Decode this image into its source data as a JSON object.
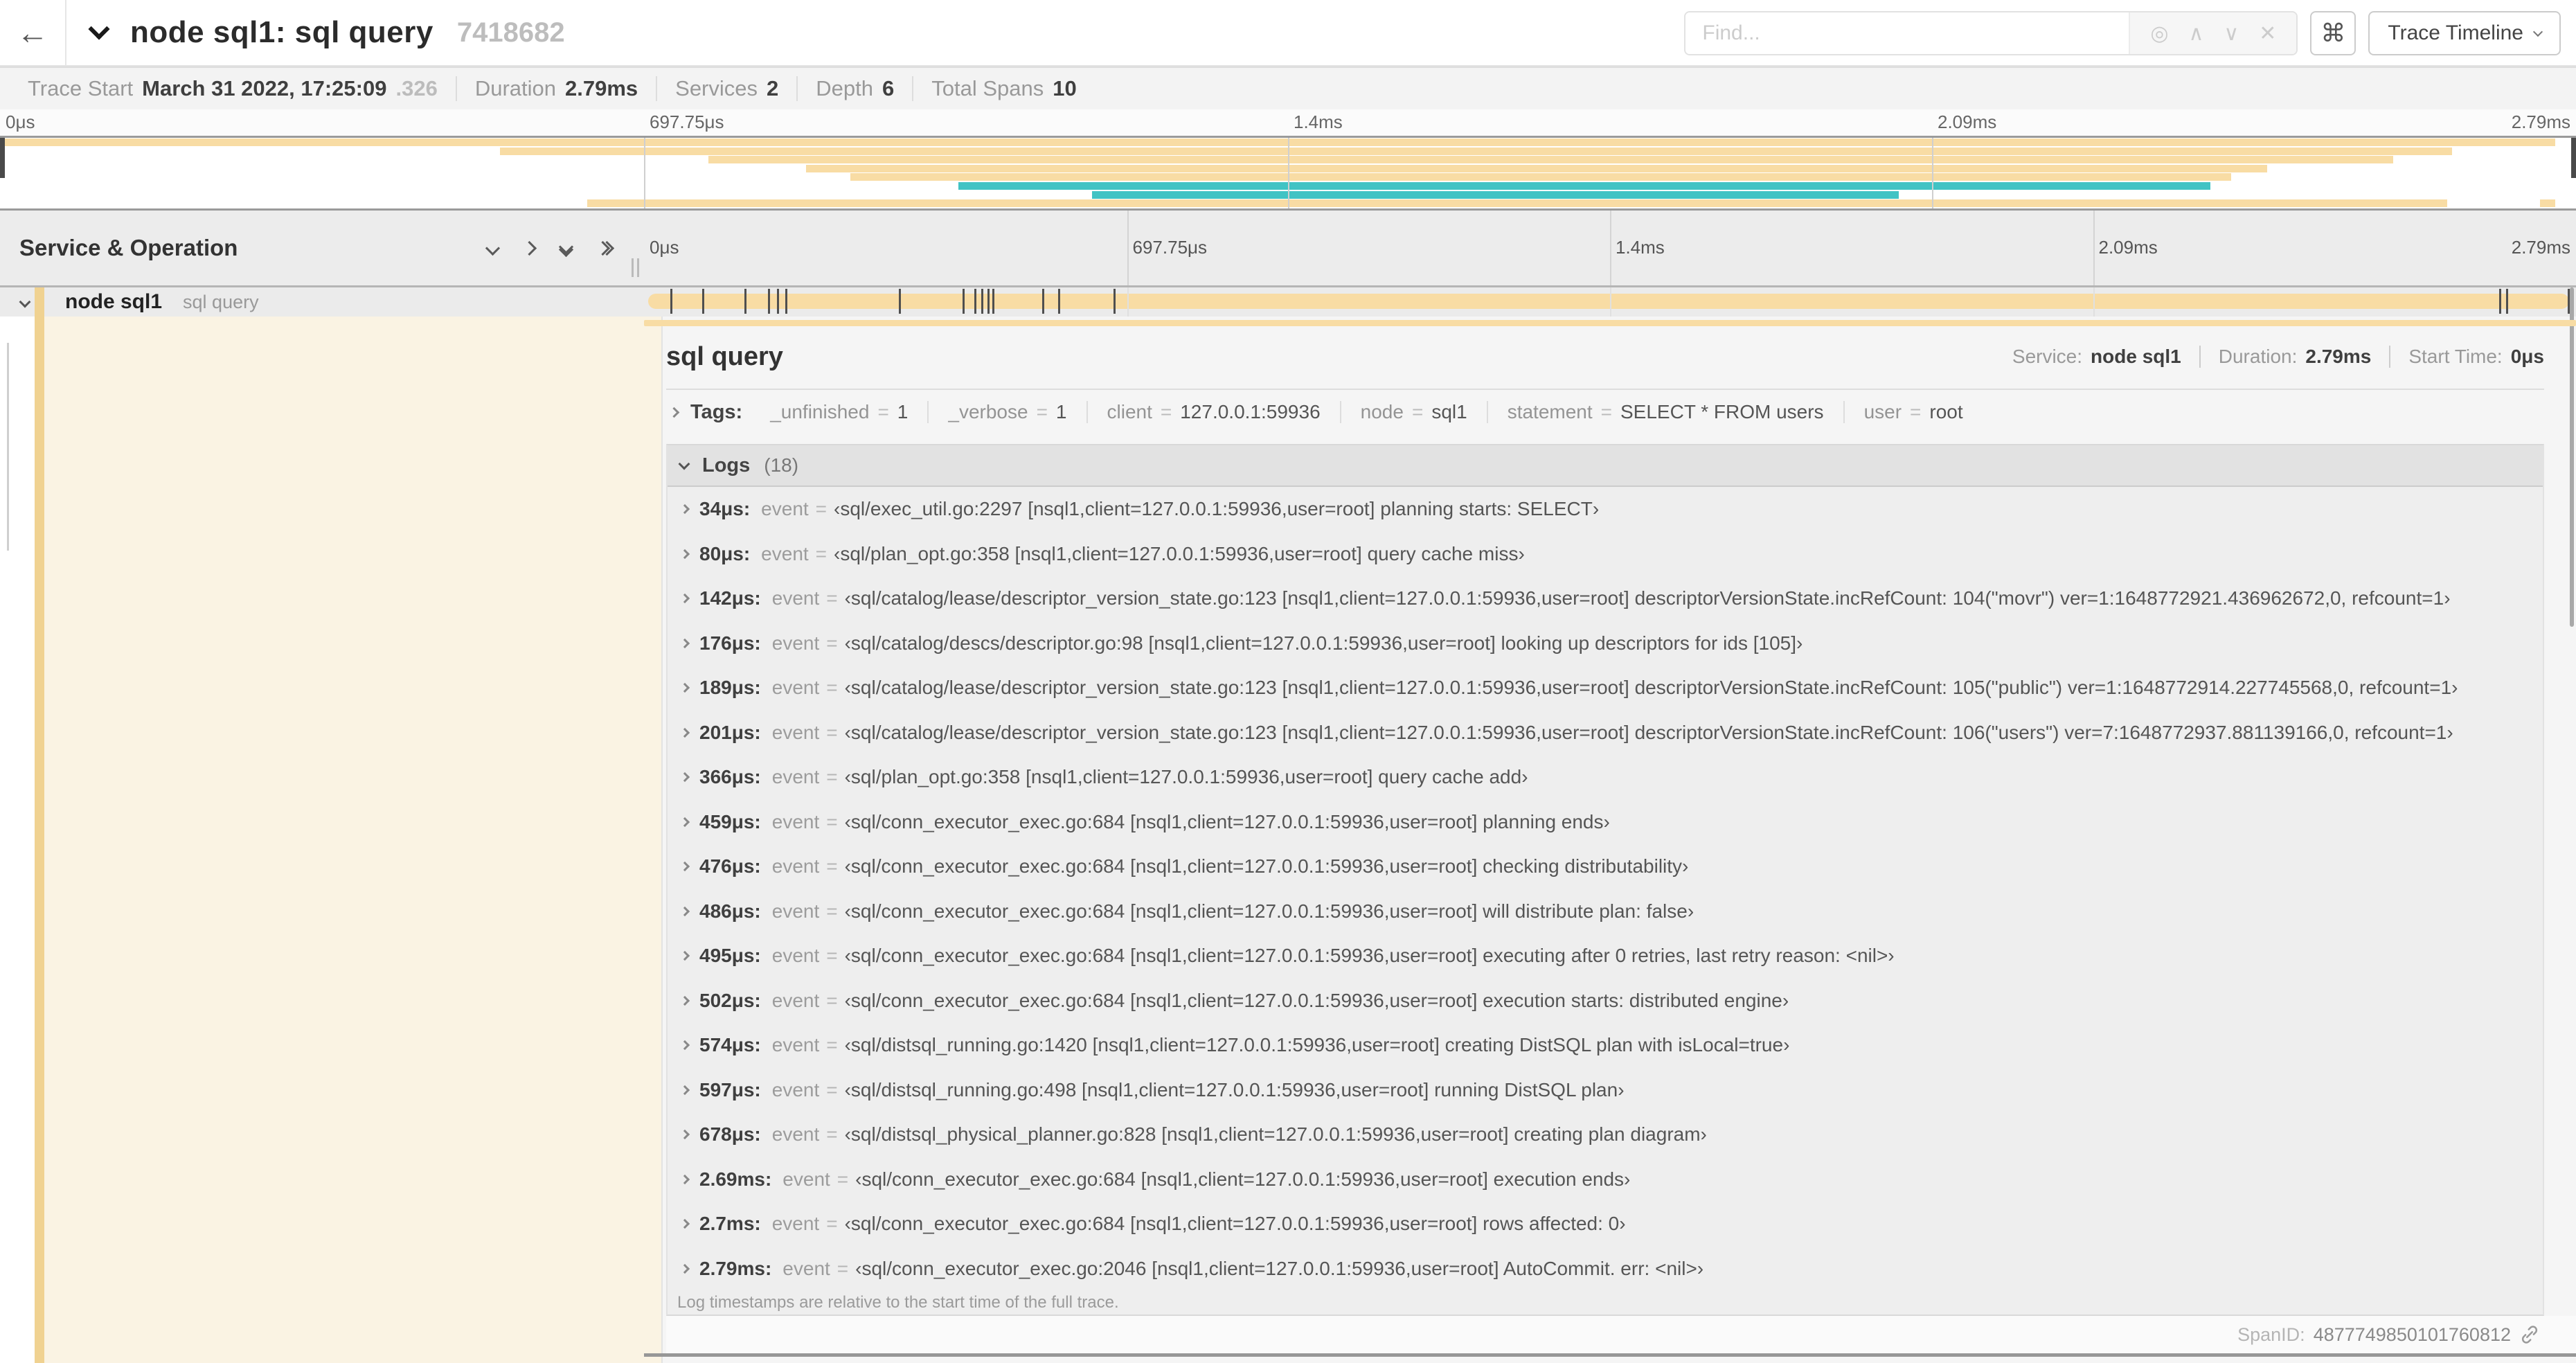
{
  "header": {
    "back_icon": "←",
    "title": "node sql1: sql query",
    "trace_id": "7418682",
    "search": {
      "placeholder": "Find...",
      "locate_icon": "◎",
      "prev_icon": "∧",
      "next_icon": "∨",
      "clear_icon": "✕"
    },
    "shortcuts_icon": "⌘",
    "view_selector_label": "Trace Timeline"
  },
  "summary": {
    "trace_start_label": "Trace Start",
    "trace_start_date": "March 31 2022, 17:25:09",
    "trace_start_frac": ".326",
    "duration_label": "Duration",
    "duration": "2.79ms",
    "services_label": "Services",
    "services": "2",
    "depth_label": "Depth",
    "depth": "6",
    "total_spans_label": "Total Spans",
    "total_spans": "10"
  },
  "timeline": {
    "duration_us": 2790,
    "ticks": [
      {
        "label": "0μs",
        "pos": 0
      },
      {
        "label": "697.75μs",
        "pos": 0.25
      },
      {
        "label": "1.4ms",
        "pos": 0.5
      },
      {
        "label": "2.09ms",
        "pos": 0.75
      },
      {
        "label": "2.79ms",
        "pos": 1
      }
    ]
  },
  "colors": {
    "amber": "#f8dca4",
    "amber_strip": "#f0d291",
    "teal": "#41c3c4",
    "cream": "#faf3e3"
  },
  "minimap": {
    "rows": [
      {
        "row": 0,
        "start": 0.0,
        "end": 0.992,
        "color": "amber"
      },
      {
        "row": 1,
        "start": 0.194,
        "end": 0.952,
        "color": "amber"
      },
      {
        "row": 2,
        "start": 0.275,
        "end": 0.929,
        "color": "amber"
      },
      {
        "row": 3,
        "start": 0.313,
        "end": 0.88,
        "color": "amber"
      },
      {
        "row": 4,
        "start": 0.33,
        "end": 0.866,
        "color": "amber"
      },
      {
        "row": 5,
        "start": 0.372,
        "end": 0.858,
        "color": "teal"
      },
      {
        "row": 6,
        "start": 0.424,
        "end": 0.737,
        "color": "teal"
      },
      {
        "row": 7,
        "start": 0.228,
        "end": 0.95,
        "color": "amber"
      },
      {
        "row": 7,
        "start": 0.986,
        "end": 0.992,
        "color": "amber"
      }
    ]
  },
  "grid_header": {
    "service_operation_label": "Service & Operation"
  },
  "span": {
    "service": "node sql1",
    "operation": "sql query"
  },
  "detail": {
    "operation": "sql query",
    "service_label": "Service:",
    "service": "node sql1",
    "duration_label": "Duration:",
    "duration": "2.79ms",
    "start_time_label": "Start Time:",
    "start_time": "0μs",
    "tags_label": "Tags:",
    "tags": [
      {
        "key": "_unfinished",
        "value": "1"
      },
      {
        "key": "_verbose",
        "value": "1"
      },
      {
        "key": "client",
        "value": "127.0.0.1:59936"
      },
      {
        "key": "node",
        "value": "sql1"
      },
      {
        "key": "statement",
        "value": "SELECT * FROM users"
      },
      {
        "key": "user",
        "value": "root"
      }
    ],
    "logs_label": "Logs",
    "logs_count": "(18)",
    "logs": [
      {
        "t": "34μs:",
        "us": 34,
        "key": "event",
        "val": "‹sql/exec_util.go:2297 [nsql1,client=127.0.0.1:59936,user=root] planning starts: SELECT›"
      },
      {
        "t": "80μs:",
        "us": 80,
        "key": "event",
        "val": "‹sql/plan_opt.go:358 [nsql1,client=127.0.0.1:59936,user=root] query cache miss›"
      },
      {
        "t": "142μs:",
        "us": 142,
        "key": "event",
        "val": "‹sql/catalog/lease/descriptor_version_state.go:123 [nsql1,client=127.0.0.1:59936,user=root] descriptorVersionState.incRefCount: 104(\"movr\") ver=1:1648772921.436962672,0, refcount=1›"
      },
      {
        "t": "176μs:",
        "us": 176,
        "key": "event",
        "val": "‹sql/catalog/descs/descriptor.go:98 [nsql1,client=127.0.0.1:59936,user=root] looking up descriptors for ids [105]›"
      },
      {
        "t": "189μs:",
        "us": 189,
        "key": "event",
        "val": "‹sql/catalog/lease/descriptor_version_state.go:123 [nsql1,client=127.0.0.1:59936,user=root] descriptorVersionState.incRefCount: 105(\"public\") ver=1:1648772914.227745568,0, refcount=1›"
      },
      {
        "t": "201μs:",
        "us": 201,
        "key": "event",
        "val": "‹sql/catalog/lease/descriptor_version_state.go:123 [nsql1,client=127.0.0.1:59936,user=root] descriptorVersionState.incRefCount: 106(\"users\") ver=7:1648772937.881139166,0, refcount=1›"
      },
      {
        "t": "366μs:",
        "us": 366,
        "key": "event",
        "val": "‹sql/plan_opt.go:358 [nsql1,client=127.0.0.1:59936,user=root] query cache add›"
      },
      {
        "t": "459μs:",
        "us": 459,
        "key": "event",
        "val": "‹sql/conn_executor_exec.go:684 [nsql1,client=127.0.0.1:59936,user=root] planning ends›"
      },
      {
        "t": "476μs:",
        "us": 476,
        "key": "event",
        "val": "‹sql/conn_executor_exec.go:684 [nsql1,client=127.0.0.1:59936,user=root] checking distributability›"
      },
      {
        "t": "486μs:",
        "us": 486,
        "key": "event",
        "val": "‹sql/conn_executor_exec.go:684 [nsql1,client=127.0.0.1:59936,user=root] will distribute plan: false›"
      },
      {
        "t": "495μs:",
        "us": 495,
        "key": "event",
        "val": "‹sql/conn_executor_exec.go:684 [nsql1,client=127.0.0.1:59936,user=root] executing after 0 retries, last retry reason: <nil>›"
      },
      {
        "t": "502μs:",
        "us": 502,
        "key": "event",
        "val": "‹sql/conn_executor_exec.go:684 [nsql1,client=127.0.0.1:59936,user=root] execution starts: distributed engine›"
      },
      {
        "t": "574μs:",
        "us": 574,
        "key": "event",
        "val": "‹sql/distsql_running.go:1420 [nsql1,client=127.0.0.1:59936,user=root] creating DistSQL plan with isLocal=true›"
      },
      {
        "t": "597μs:",
        "us": 597,
        "key": "event",
        "val": "‹sql/distsql_running.go:498 [nsql1,client=127.0.0.1:59936,user=root] running DistSQL plan›"
      },
      {
        "t": "678μs:",
        "us": 678,
        "key": "event",
        "val": "‹sql/distsql_physical_planner.go:828 [nsql1,client=127.0.0.1:59936,user=root] creating plan diagram›"
      },
      {
        "t": "2.69ms:",
        "us": 2690,
        "key": "event",
        "val": "‹sql/conn_executor_exec.go:684 [nsql1,client=127.0.0.1:59936,user=root] execution ends›"
      },
      {
        "t": "2.7ms:",
        "us": 2700,
        "key": "event",
        "val": "‹sql/conn_executor_exec.go:684 [nsql1,client=127.0.0.1:59936,user=root] rows affected: 0›"
      },
      {
        "t": "2.79ms:",
        "us": 2790,
        "key": "event",
        "val": "‹sql/conn_executor_exec.go:2046 [nsql1,client=127.0.0.1:59936,user=root] AutoCommit. err: <nil>›"
      }
    ],
    "logs_note": "Log timestamps are relative to the start time of the full trace.",
    "span_id_label": "SpanID:",
    "span_id": "4877749850101760812"
  }
}
